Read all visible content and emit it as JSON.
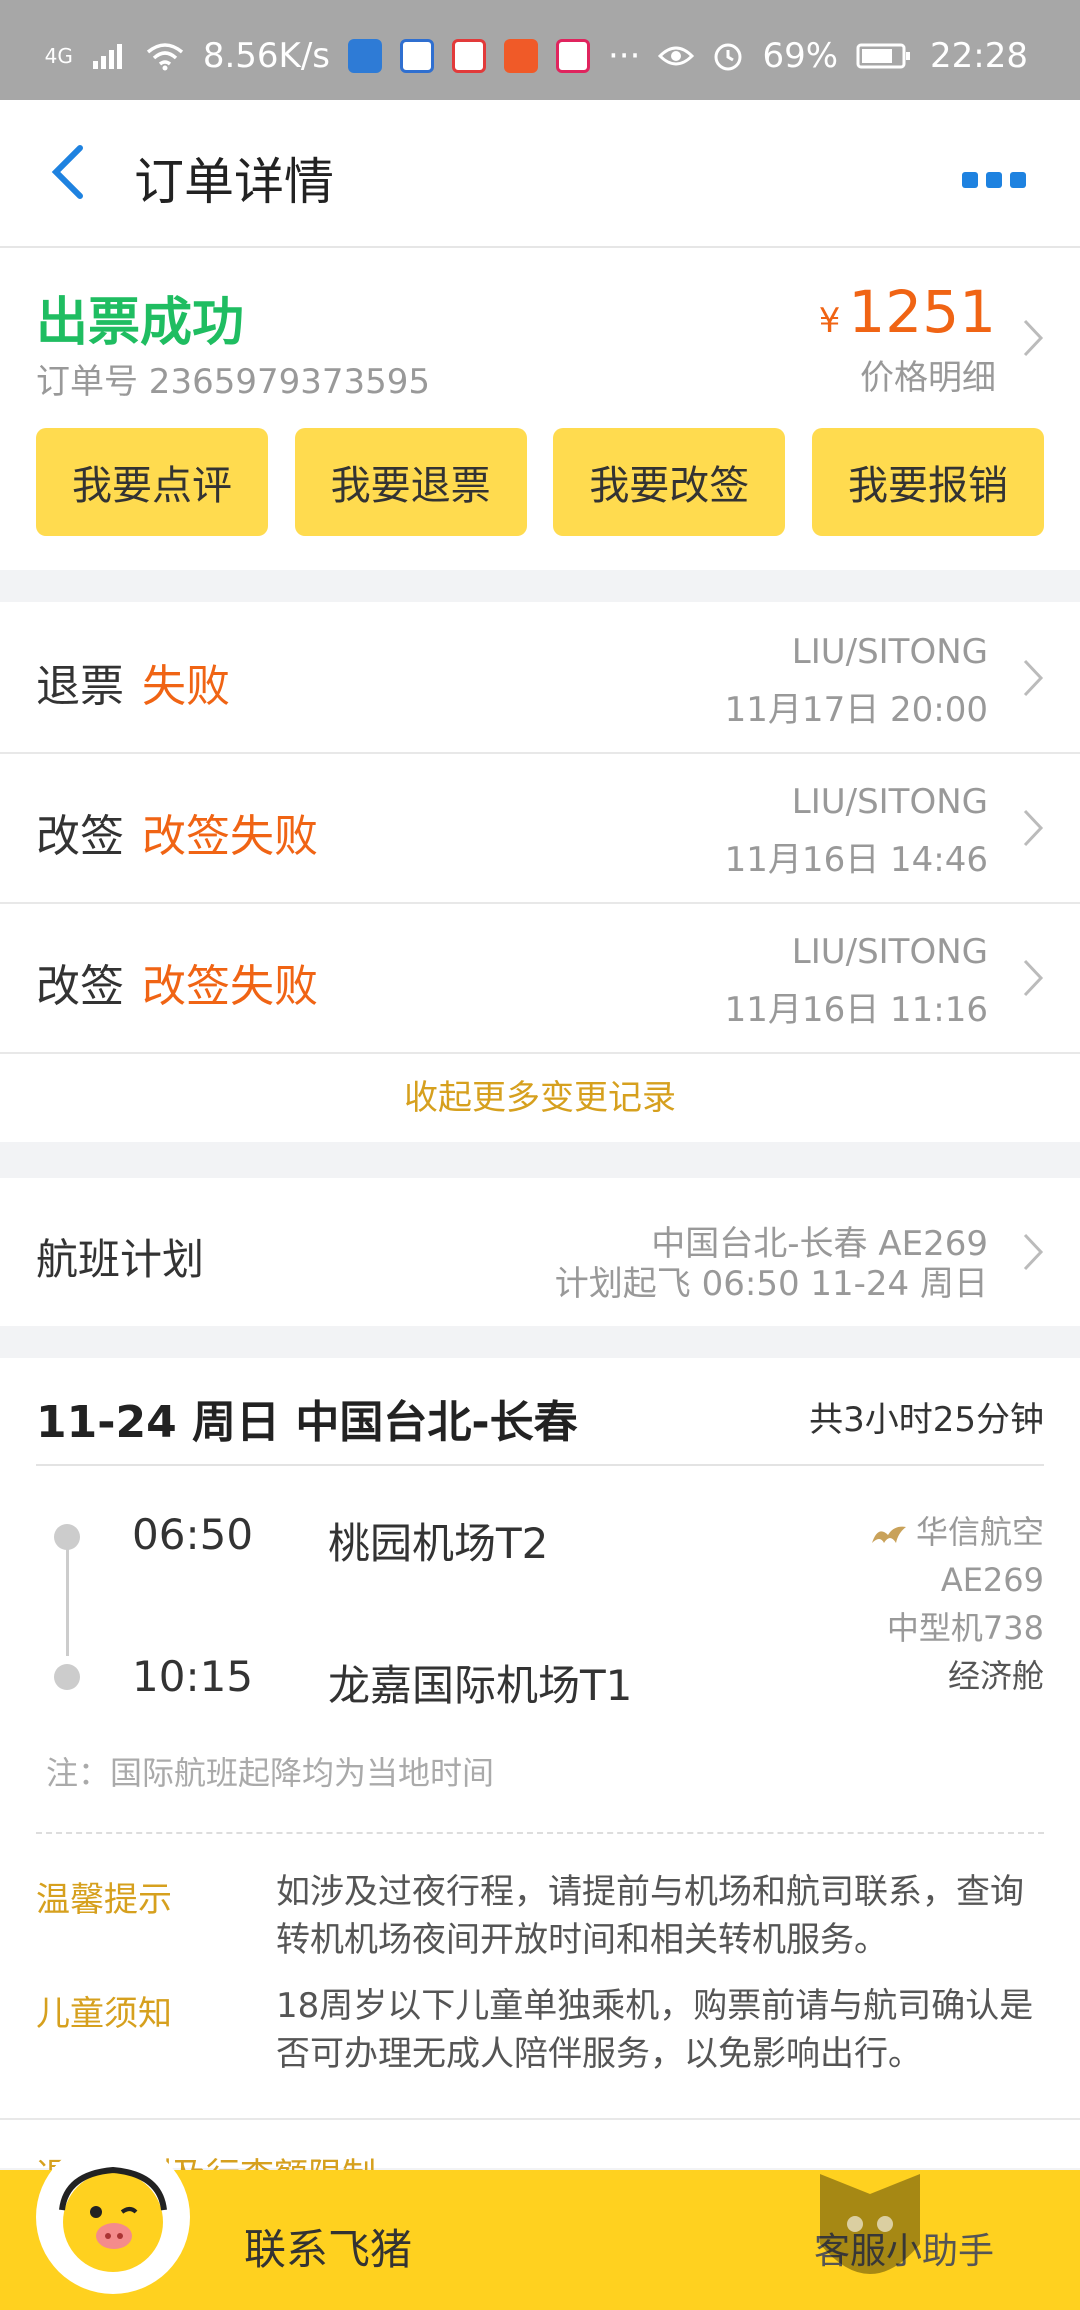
{
  "status_bar": {
    "network": "4G",
    "speed": "8.56K/s",
    "more": "···",
    "battery": "69%",
    "time": "22:28",
    "app_colors": [
      "#2e7bd6",
      "#2f6fd0",
      "#e23a3a",
      "#f05a28",
      "#e0245e"
    ]
  },
  "nav": {
    "title": "订单详情",
    "back_icon": "chevron-left-icon",
    "more_icon": "more-icon",
    "accent": "#1e82e0"
  },
  "order": {
    "status": "出票成功",
    "order_no": "订单号 2365979373595",
    "currency": "¥",
    "price": "1251",
    "price_detail": "价格明细",
    "actions": [
      "我要点评",
      "我要退票",
      "我要改签",
      "我要报销"
    ]
  },
  "records": [
    {
      "type": "退票",
      "result": "失败",
      "name": "LIU/SITONG",
      "time": "11月17日 20:00"
    },
    {
      "type": "改签",
      "result": "改签失败",
      "name": "LIU/SITONG",
      "time": "11月16日 14:46"
    },
    {
      "type": "改签",
      "result": "改签失败",
      "name": "LIU/SITONG",
      "time": "11月16日 11:16"
    }
  ],
  "collapse_label": "收起更多变更记录",
  "plan": {
    "label": "航班计划",
    "route": "中国台北-长春 AE269",
    "schedule": "计划起飞 06:50 11-24 周日"
  },
  "flight": {
    "header": "11-24 周日 中国台北-长春",
    "duration": "共3小时25分钟",
    "dep_time": "06:50",
    "dep_airport": "桃园机场T2",
    "arr_time": "10:15",
    "arr_airport": "龙嘉国际机场T1",
    "airline": "华信航空",
    "flight_no": "AE269",
    "aircraft": "中型机738",
    "cabin": "经济舱",
    "note": "注：国际航班起降均为当地时间"
  },
  "tips": [
    {
      "label": "温馨提示",
      "text": "如涉及过夜行程，请提前与机场和航司联系，查询转机机场夜间开放时间和相关转机服务。"
    },
    {
      "label": "儿童须知",
      "text": "18周岁以下儿童单独乘机，购票前请与航司确认是否可办理无成人陪伴服务，以免影响出行。"
    }
  ],
  "rules_label": "退改规则及行李额限制",
  "bottom_bar": {
    "contact": "联系飞猪",
    "helper": "客服小助手",
    "watermark": "黑猫 BLACK CAT"
  },
  "colors": {
    "success": "#1fbd61",
    "price": "#f06414",
    "button": "#ffdb4f",
    "gold": "#d6a01e",
    "bottom": "#ffd11f"
  }
}
